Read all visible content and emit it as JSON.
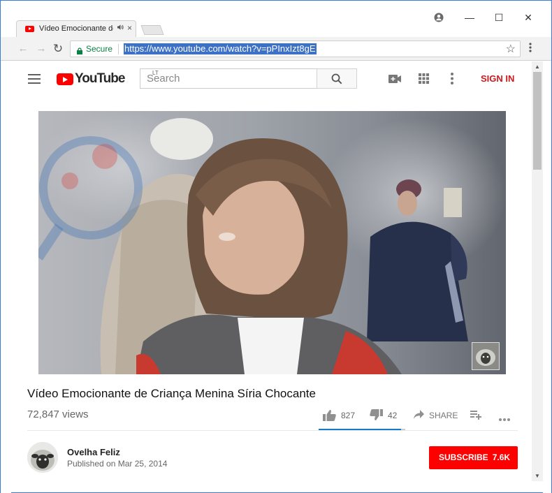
{
  "browser": {
    "tab": {
      "title": "Vídeo Emocionante de",
      "audio_icon": "speaker-icon",
      "close_glyph": "×"
    },
    "window_controls": {
      "minimize": "—",
      "maximize": "☐",
      "close": "✕"
    },
    "toolbar": {
      "back_glyph": "←",
      "forward_glyph": "→",
      "reload_glyph": "↻",
      "secure_label": "Secure",
      "url": "https://www.youtube.com/watch?v=pPInxIzt8gE",
      "star_glyph": "☆",
      "menu_glyph": "⋮"
    },
    "scroll": {
      "up_glyph": "▲",
      "down_glyph": "▼"
    }
  },
  "youtube": {
    "header": {
      "logo_text": "YouTube",
      "region": "LT",
      "search_placeholder": "Search",
      "sign_in": "SIGN IN"
    },
    "video": {
      "title": "Vídeo Emocionante de Criança Menina Síria Chocante",
      "views": "72,847 views",
      "likes": "827",
      "dislikes": "42",
      "share_label": "SHARE",
      "like_ratio": 0.95
    },
    "owner": {
      "name": "Ovelha Feliz",
      "published": "Published on Mar 25, 2014",
      "subscribe_label": "SUBSCRIBE",
      "subscriber_count": "7.6K"
    }
  },
  "colors": {
    "youtube_red": "#ff0000",
    "sign_in_red": "#cc181e",
    "secure_green": "#0b8043",
    "url_highlight": "#3d71c5",
    "sentiment_blue": "#167ac6"
  }
}
